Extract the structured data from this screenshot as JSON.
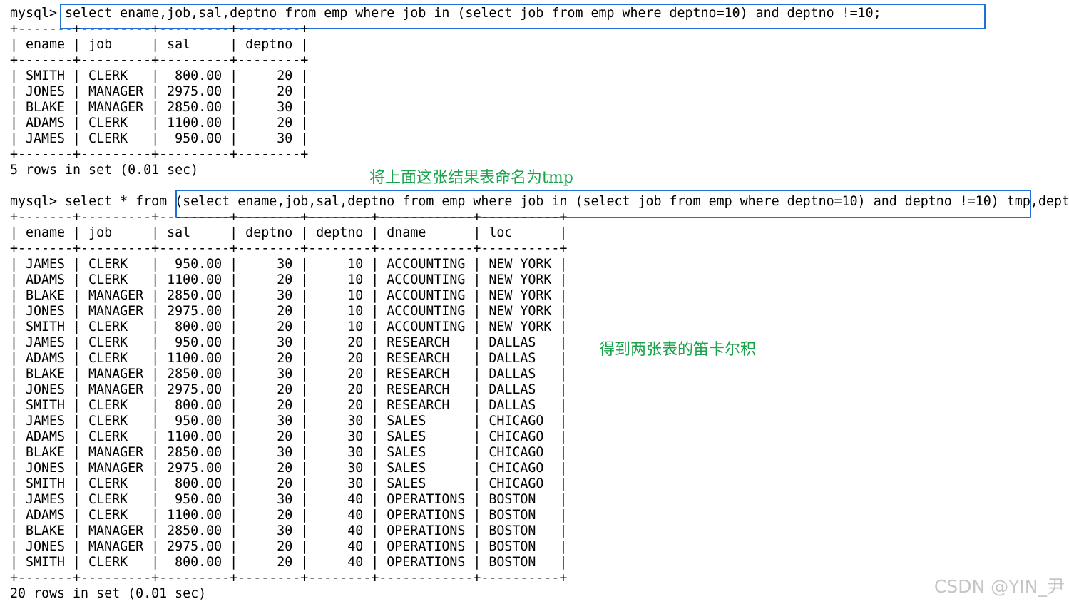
{
  "terminal": {
    "query1": {
      "prompt": "mysql> ",
      "sql": "select ename,job,sal,deptno from emp where job in (select job from emp where deptno=10) and deptno !=10;",
      "columns": [
        "ename",
        "job",
        "sal",
        "deptno"
      ],
      "rows": [
        [
          "SMITH",
          "CLERK",
          "800.00",
          "20"
        ],
        [
          "JONES",
          "MANAGER",
          "2975.00",
          "20"
        ],
        [
          "BLAKE",
          "MANAGER",
          "2850.00",
          "30"
        ],
        [
          "ADAMS",
          "CLERK",
          "1100.00",
          "20"
        ],
        [
          "JAMES",
          "CLERK",
          "950.00",
          "30"
        ]
      ],
      "summary": "5 rows in set (0.01 sec)"
    },
    "query2": {
      "prompt": "mysql> ",
      "sql_prefix": "select * from ",
      "sql_subquery": "(select ename,job,sal,deptno from emp where job in (select job from emp where deptno=10) and deptno !=10) tmp",
      "sql_suffix": ",dept",
      "columns": [
        "ename",
        "job",
        "sal",
        "deptno",
        "deptno",
        "dname",
        "loc"
      ],
      "rows": [
        [
          "JAMES",
          "CLERK",
          "950.00",
          "30",
          "10",
          "ACCOUNTING",
          "NEW YORK"
        ],
        [
          "ADAMS",
          "CLERK",
          "1100.00",
          "20",
          "10",
          "ACCOUNTING",
          "NEW YORK"
        ],
        [
          "BLAKE",
          "MANAGER",
          "2850.00",
          "30",
          "10",
          "ACCOUNTING",
          "NEW YORK"
        ],
        [
          "JONES",
          "MANAGER",
          "2975.00",
          "20",
          "10",
          "ACCOUNTING",
          "NEW YORK"
        ],
        [
          "SMITH",
          "CLERK",
          "800.00",
          "20",
          "10",
          "ACCOUNTING",
          "NEW YORK"
        ],
        [
          "JAMES",
          "CLERK",
          "950.00",
          "30",
          "20",
          "RESEARCH",
          "DALLAS"
        ],
        [
          "ADAMS",
          "CLERK",
          "1100.00",
          "20",
          "20",
          "RESEARCH",
          "DALLAS"
        ],
        [
          "BLAKE",
          "MANAGER",
          "2850.00",
          "30",
          "20",
          "RESEARCH",
          "DALLAS"
        ],
        [
          "JONES",
          "MANAGER",
          "2975.00",
          "20",
          "20",
          "RESEARCH",
          "DALLAS"
        ],
        [
          "SMITH",
          "CLERK",
          "800.00",
          "20",
          "20",
          "RESEARCH",
          "DALLAS"
        ],
        [
          "JAMES",
          "CLERK",
          "950.00",
          "30",
          "30",
          "SALES",
          "CHICAGO"
        ],
        [
          "ADAMS",
          "CLERK",
          "1100.00",
          "20",
          "30",
          "SALES",
          "CHICAGO"
        ],
        [
          "BLAKE",
          "MANAGER",
          "2850.00",
          "30",
          "30",
          "SALES",
          "CHICAGO"
        ],
        [
          "JONES",
          "MANAGER",
          "2975.00",
          "20",
          "30",
          "SALES",
          "CHICAGO"
        ],
        [
          "SMITH",
          "CLERK",
          "800.00",
          "20",
          "30",
          "SALES",
          "CHICAGO"
        ],
        [
          "JAMES",
          "CLERK",
          "950.00",
          "30",
          "40",
          "OPERATIONS",
          "BOSTON"
        ],
        [
          "ADAMS",
          "CLERK",
          "1100.00",
          "20",
          "40",
          "OPERATIONS",
          "BOSTON"
        ],
        [
          "BLAKE",
          "MANAGER",
          "2850.00",
          "30",
          "40",
          "OPERATIONS",
          "BOSTON"
        ],
        [
          "JONES",
          "MANAGER",
          "2975.00",
          "20",
          "40",
          "OPERATIONS",
          "BOSTON"
        ],
        [
          "SMITH",
          "CLERK",
          "800.00",
          "20",
          "40",
          "OPERATIONS",
          "BOSTON"
        ]
      ],
      "summary": "20 rows in set (0.01 sec)"
    }
  },
  "annotations": {
    "name_result_table": "将上面这张结果表命名为tmp",
    "cartesian_product": "得到两张表的笛卡尔积"
  },
  "watermark": "CSDN @YIN_尹",
  "colors": {
    "highlight_border": "#1e6fd9",
    "annotation_text": "#19a34a",
    "watermark_text": "#c6c6c6"
  }
}
